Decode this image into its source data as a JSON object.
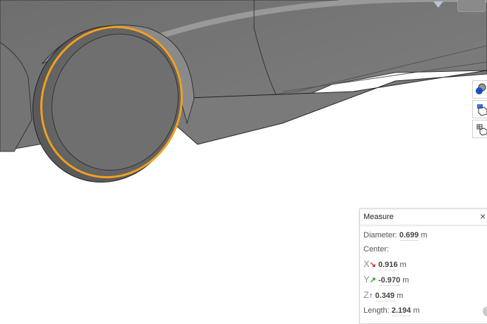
{
  "measure": {
    "title": "Measure",
    "close_icon": "×",
    "diameter_label": "Diameter:",
    "diameter_value": "0.699",
    "center_label": "Center:",
    "x_label": "X",
    "x_arrow": "↘",
    "x_value": "0.916",
    "y_label": "Y",
    "y_arrow": "↗",
    "y_value": "-0.970",
    "z_label": "Z",
    "z_arrow": "↑",
    "z_value": "0.349",
    "length_label": "Length:",
    "length_value": "2.194",
    "unit": "m",
    "help_icon": "?",
    "colors": {
      "x": "#e02020",
      "y": "#20a020",
      "z": "#1030c0",
      "selection": "#f0a020"
    }
  },
  "toolbar": {
    "items": [
      {
        "icon": "appearance-icon"
      },
      {
        "icon": "section-view-icon"
      },
      {
        "icon": "explode-view-icon"
      }
    ]
  }
}
